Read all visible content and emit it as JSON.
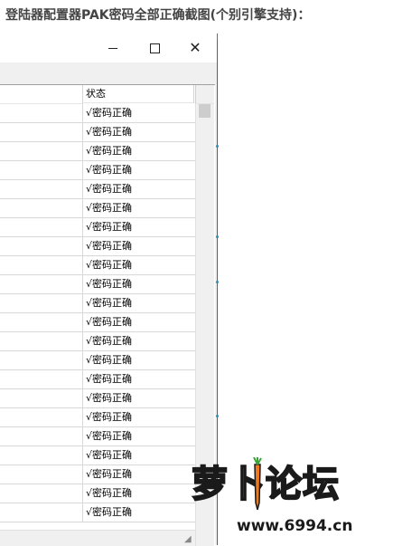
{
  "page": {
    "heading": "登陆器配置器PAK密码全部正确截图(个别引擎支持)："
  },
  "window": {
    "close_glyph": "✕"
  },
  "list": {
    "column_header": "状态",
    "rows": [
      "√密码正确",
      "√密码正确",
      "√密码正确",
      "√密码正确",
      "√密码正确",
      "√密码正确",
      "√密码正确",
      "√密码正确",
      "√密码正确",
      "√密码正确",
      "√密码正确",
      "√密码正确",
      "√密码正确",
      "√密码正确",
      "√密码正确",
      "√密码正确",
      "√密码正确",
      "√密码正确",
      "√密码正确",
      "√密码正确",
      "√密码正确",
      "√密码正确"
    ]
  },
  "watermark": {
    "logo_text": "萝卜论坛",
    "url": "www.6994.cn",
    "colors": {
      "fill": "#ffe600",
      "outline": "#1a1a1a",
      "carrot": "#f07a1a"
    }
  },
  "icons": {
    "minimize": "minimize-icon",
    "maximize": "maximize-icon",
    "close": "close-icon"
  }
}
